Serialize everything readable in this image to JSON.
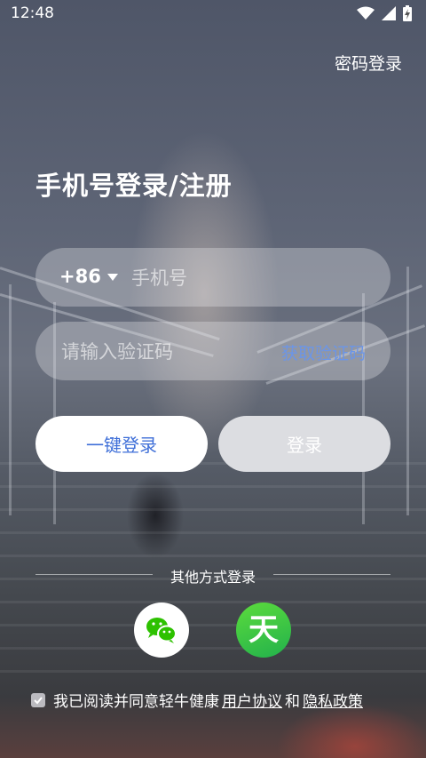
{
  "status_bar": {
    "time": "12:48",
    "icons": [
      "wifi-icon",
      "signal-icon",
      "battery-charging-icon"
    ]
  },
  "header": {
    "password_login": "密码登录"
  },
  "title": "手机号登录/注册",
  "phone": {
    "country_code": "+86",
    "placeholder": "手机号"
  },
  "code": {
    "placeholder": "请输入验证码",
    "get_code": "获取验证码"
  },
  "buttons": {
    "one_key_login": "一键登录",
    "login": "登录"
  },
  "other_login": {
    "label": "其他方式登录",
    "icons": [
      "wechat-icon",
      "tianyi-icon"
    ],
    "tianyi_glyph": "天"
  },
  "agreement": {
    "text": "我已阅读并同意轻牛健康",
    "user_agreement": "用户协议",
    "and": "和",
    "privacy_policy": "隐私政策",
    "checked": true
  },
  "colors": {
    "accent": "#3f6fd8",
    "link": "#6b95e8",
    "login_disabled": "#dcdde1"
  }
}
